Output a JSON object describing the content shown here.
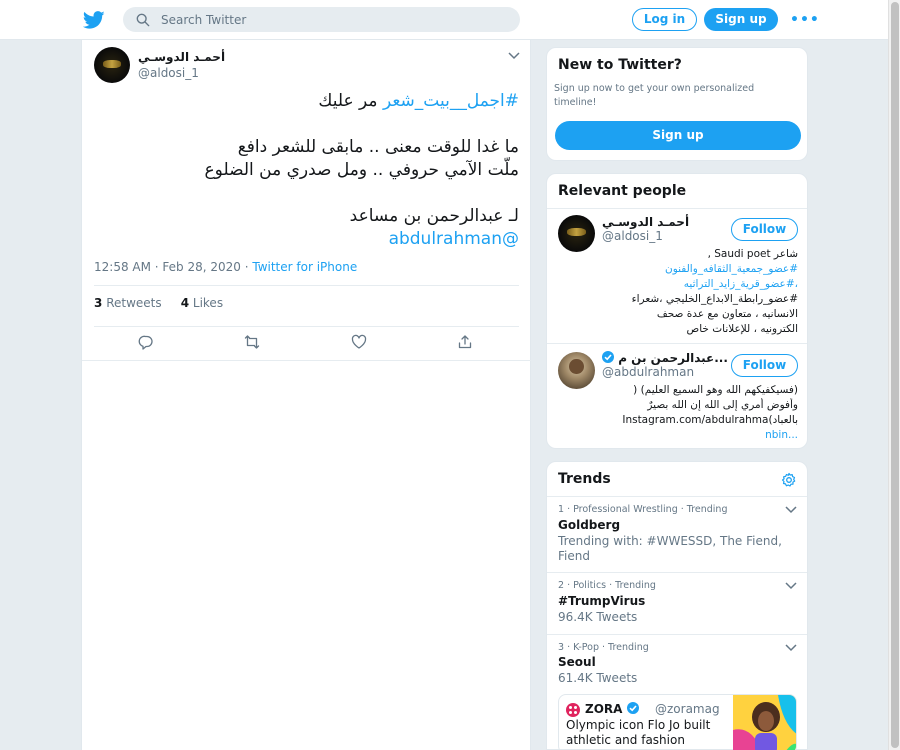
{
  "header": {
    "search_placeholder": "Search Twitter",
    "login_label": "Log in",
    "signup_label": "Sign up",
    "more_label": "•••"
  },
  "tweet": {
    "author_name": "أحمـد الدوسـي",
    "author_handle": "@aldosi_1",
    "lines": [
      {
        "hashtag": "#اجمل__بيت_شعر",
        "text": " مر عليك"
      },
      {
        "text": "ما غدا للوقت معنى .. مابقى للشعر دافع"
      },
      {
        "text": "ملّت الآمي حروفي .. ومل صدري من الضلوع"
      },
      {
        "text": "لـ عبدالرحمن بن مساعد"
      },
      {
        "mention": "@abdulrahman"
      }
    ],
    "time": "12:58 AM · Feb 28, 2020",
    "separator": " · ",
    "source": "Twitter for iPhone",
    "retweets_count": "3",
    "retweets_label": "Retweets",
    "likes_count": "4",
    "likes_label": "Likes"
  },
  "new_to_twitter": {
    "title": "New to Twitter?",
    "text": "Sign up now to get your own personalized timeline!",
    "button": "Sign up"
  },
  "relevant_people": {
    "title": "Relevant people",
    "people": [
      {
        "name": "أحمـد الدوسـي",
        "handle": "@aldosi_1",
        "follow": "Follow",
        "bio": [
          "شاعر Saudi poet ,",
          "#عضو_جمعية_الثقافه_والفنون",
          "،#عضو_قرية_زايد_التراثيه",
          "#عضو_رابطة_الابداع_الخليجي ،شعراء",
          "الانسانيه ، متعاون مع عدة صحف",
          "الكترونيه ، للإعلانات خاص"
        ]
      },
      {
        "name": "عبدالرحمن بن م...",
        "handle": "@abdulrahman",
        "follow": "Follow",
        "bio": [
          "(فسيكفيكهم الله وهو السميع العليم) (",
          "وأفوض أمري إلى الله إن الله بصيرٌ",
          "بالعباد)Instagram.com/abdulrahma",
          "nbin..."
        ]
      }
    ]
  },
  "trends": {
    "title": "Trends",
    "items": [
      {
        "meta": "1 · Professional Wrestling · Trending",
        "name": "Goldberg",
        "sub": "Trending with: #WWESSD, The Fiend, Fiend"
      },
      {
        "meta": "2 · Politics · Trending",
        "name": "#TrumpVirus",
        "sub": "96.4K Tweets"
      },
      {
        "meta": "3 · K-Pop · Trending",
        "name": "Seoul",
        "sub": "61.4K Tweets"
      }
    ],
    "card": {
      "name": "ZORA",
      "handle": "@zoramag",
      "text": "Olympic icon Flo Jo built athletic and fashion caree..."
    }
  },
  "colors": {
    "accent": "#1da1f2",
    "background": "#e6ecf0",
    "secondary_text": "#657786"
  }
}
